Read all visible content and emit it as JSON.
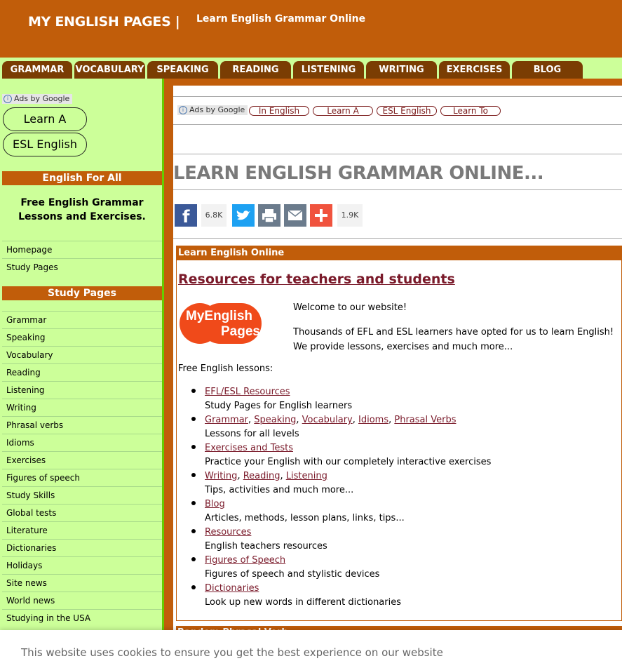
{
  "header": {
    "site_title": "MY ENGLISH PAGES |",
    "tagline": "Learn English Grammar Online"
  },
  "nav": {
    "tabs": [
      "GRAMMAR",
      "VOCABULARY",
      "SPEAKING",
      "READING",
      "LISTENING",
      "WRITING",
      "EXERCISES",
      "BLOG"
    ]
  },
  "sidebar": {
    "ads_label": "Ads by Google",
    "ads": [
      "Learn A",
      "ESL English"
    ],
    "section1_title": "English For All",
    "section1_text": "Free English Grammar Lessons and Exercises.",
    "links1": [
      "Homepage",
      "Study Pages"
    ],
    "section2_title": "Study Pages",
    "links2": [
      "Grammar",
      "Speaking",
      "Vocabulary",
      "Reading",
      "Listening",
      "Writing",
      "Phrasal verbs",
      "Idioms",
      "Exercises",
      "Figures of speech",
      "Study Skills",
      "Global tests",
      "Literature",
      "Dictionaries",
      "Holidays",
      "Site news",
      "World news",
      "Studying in the USA"
    ]
  },
  "top_ads": {
    "label": "Ads by Google",
    "items": [
      "In English",
      "Learn A",
      "ESL English",
      "Learn To"
    ]
  },
  "main": {
    "page_title": "LEARN ENGLISH GRAMMAR ONLINE...",
    "share": {
      "facebook_count": "6.8K",
      "more_count": "1.9K",
      "icons": [
        "facebook-icon",
        "twitter-icon",
        "print-icon",
        "email-icon",
        "plus-icon"
      ]
    },
    "box_title": "Learn English Online",
    "resources_title": "Resources for teachers and students",
    "logo_line1": "MyEnglish",
    "logo_line2": "Pages.COM",
    "welcome": "Welcome to our website!",
    "intro": "Thousands of EFL and ESL learners have opted for us to learn English! We provide lessons, exercises and much more...",
    "free_label": "Free English lessons:",
    "items": [
      {
        "links": [
          "EFL/ESL Resources"
        ],
        "desc": "Study Pages for English learners"
      },
      {
        "links": [
          "Grammar",
          "Speaking",
          "Vocabulary",
          "Idioms",
          "Phrasal Verbs"
        ],
        "desc": "Lessons for all levels"
      },
      {
        "links": [
          "Exercises and Tests"
        ],
        "desc": "Practice your English with our completely interactive exercises"
      },
      {
        "links": [
          "Writing",
          "Reading",
          "Listening"
        ],
        "desc": "Tips, activities and much more..."
      },
      {
        "links": [
          "Blog"
        ],
        "desc": "Articles, methods, lesson plans, links, tips..."
      },
      {
        "links": [
          "Resources "
        ],
        "desc": "English teachers resources"
      },
      {
        "links": [
          "Figures of Speech"
        ],
        "desc": "Figures of speech and stylistic devices"
      },
      {
        "links": [
          "Dictionaries"
        ],
        "desc": "Look up new words in different dictionaries"
      }
    ],
    "next_box_title": "Random Phrasal Verb"
  },
  "cookie": {
    "text": "This website uses cookies to ensure you get the best experience on our website"
  },
  "colors": {
    "brand_orange": "#c15d0a",
    "tab_brown": "#7a3d03",
    "sidebar_green": "#ccff99",
    "link_maroon": "#7a1a2a"
  }
}
